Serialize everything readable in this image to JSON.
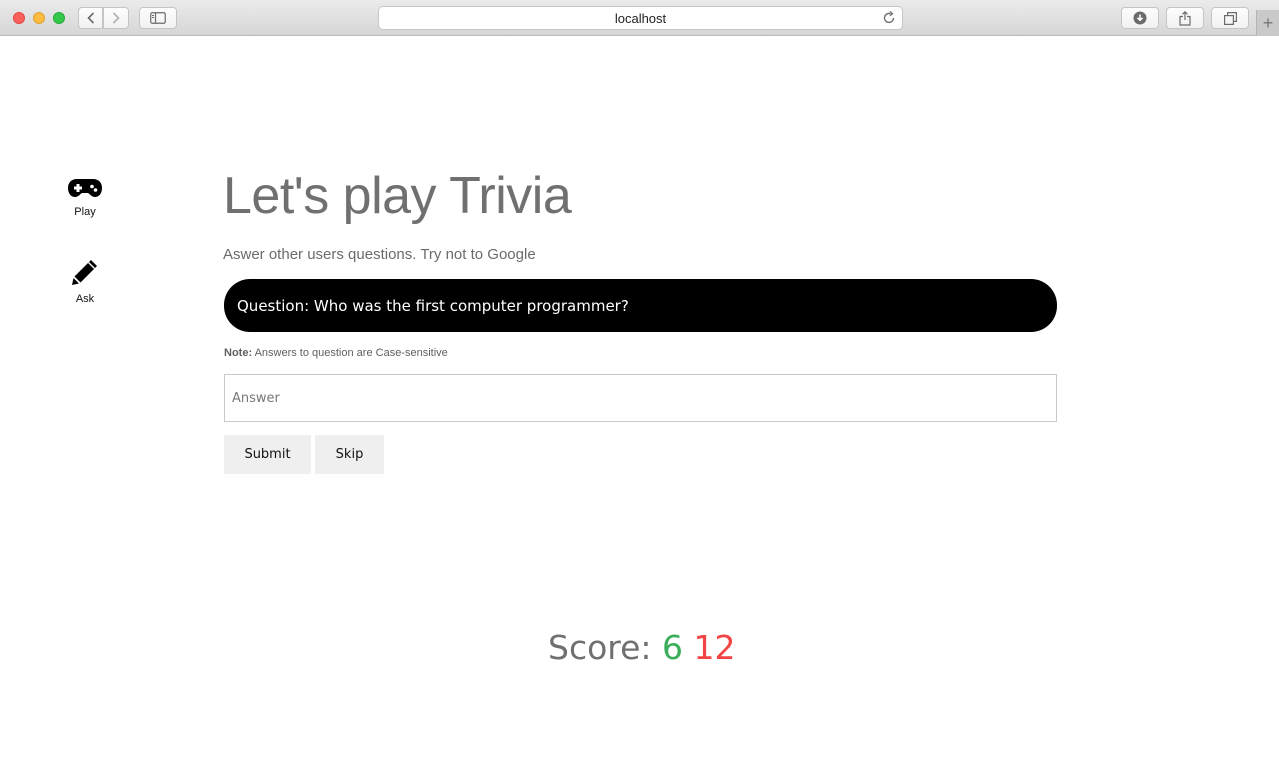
{
  "browser": {
    "url": "localhost",
    "new_tab_label": "+"
  },
  "sidebar": {
    "items": [
      {
        "label": "Play",
        "icon": "gamepad-icon"
      },
      {
        "label": "Ask",
        "icon": "pencil-icon"
      }
    ]
  },
  "main": {
    "title": "Let's play Trivia",
    "subtitle": "Aswer other users questions. Try not to Google",
    "question": "Question: Who was the first computer programmer?",
    "note_label": "Note:",
    "note_text": "Answers to question are Case-sensitive",
    "answer_placeholder": "Answer",
    "answer_value": "",
    "submit_label": "Submit",
    "skip_label": "Skip"
  },
  "score": {
    "label": "Score:",
    "correct": "6",
    "wrong": "12",
    "correct_color": "#3cae5b",
    "wrong_color": "#f24444"
  }
}
